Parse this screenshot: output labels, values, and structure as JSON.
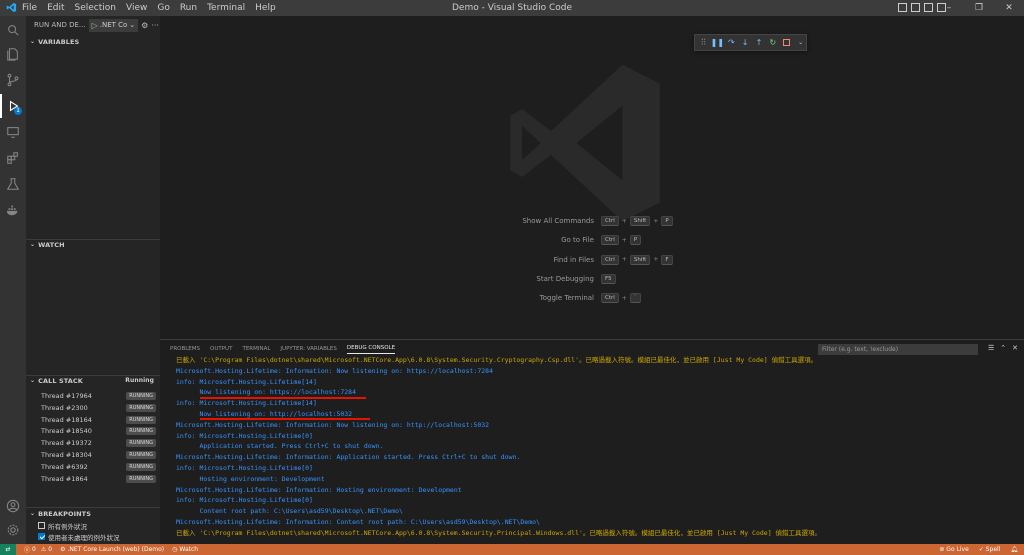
{
  "titlebar": {
    "menus": [
      "File",
      "Edit",
      "Selection",
      "View",
      "Go",
      "Run",
      "Terminal",
      "Help"
    ],
    "window_title": "Demo - Visual Studio Code",
    "window_controls": [
      "–",
      "❐",
      "✕"
    ]
  },
  "activity_badge": "1",
  "sidebar": {
    "run_label": "RUN AND DE...",
    "config_name": ".NET Co",
    "variables_header": "VARIABLES",
    "watch_header": "WATCH",
    "callstack_header": "CALL STACK",
    "callstack_status": "Running",
    "threads": [
      {
        "name": "Thread #17964",
        "state": "RUNNING"
      },
      {
        "name": "Thread #2300",
        "state": "RUNNING"
      },
      {
        "name": "Thread #18164",
        "state": "RUNNING"
      },
      {
        "name": "Thread #18540",
        "state": "RUNNING"
      },
      {
        "name": "Thread #19372",
        "state": "RUNNING"
      },
      {
        "name": "Thread #18304",
        "state": "RUNNING"
      },
      {
        "name": "Thread #6392",
        "state": "RUNNING"
      },
      {
        "name": "Thread #1864",
        "state": "RUNNING"
      }
    ],
    "breakpoints_header": "BREAKPOINTS",
    "breakpoints": [
      {
        "label": "所有例外狀況",
        "checked": false
      },
      {
        "label": "使用者未處理的例外狀況",
        "checked": true
      }
    ]
  },
  "editor": {
    "shortcuts": [
      {
        "label": "Show All Commands",
        "keys": [
          "Ctrl",
          "Shift",
          "P"
        ]
      },
      {
        "label": "Go to File",
        "keys": [
          "Ctrl",
          "P"
        ]
      },
      {
        "label": "Find in Files",
        "keys": [
          "Ctrl",
          "Shift",
          "F"
        ]
      },
      {
        "label": "Start Debugging",
        "keys": [
          "F5"
        ]
      },
      {
        "label": "Toggle Terminal",
        "keys": [
          "Ctrl",
          "`"
        ]
      }
    ]
  },
  "panel": {
    "tabs": [
      "PROBLEMS",
      "OUTPUT",
      "TERMINAL",
      "JUPYTER: VARIABLES",
      "DEBUG CONSOLE"
    ],
    "active_tab": "DEBUG CONSOLE",
    "filter_placeholder": "Filter (e.g. text, !exclude)",
    "console_lines": [
      {
        "text": "已載入 'C:\\Program Files\\dotnet\\shared\\Microsoft.NETCore.App\\6.0.8\\System.Security.Cryptography.Csp.dll'。已略過載入符號。模組已最佳化，並已啟用 [Just My Code] 偵錯工具選項。",
        "color": "yellow"
      },
      {
        "text": "Microsoft.Hosting.Lifetime: Information: Now listening on: https://localhost:7284",
        "color": "blue"
      },
      {
        "text": "info: Microsoft.Hosting.Lifetime[14]",
        "color": "blue"
      },
      {
        "text": "      Now listening on: https://localhost:7284",
        "color": "blue"
      },
      {
        "text": "info: Microsoft.Hosting.Lifetime[14]",
        "color": "blue"
      },
      {
        "text": "      Now listening on: http://localhost:5032",
        "color": "blue"
      },
      {
        "text": "Microsoft.Hosting.Lifetime: Information: Now listening on: http://localhost:5032",
        "color": "blue"
      },
      {
        "text": "info: Microsoft.Hosting.Lifetime[0]",
        "color": "blue"
      },
      {
        "text": "      Application started. Press Ctrl+C to shut down.",
        "color": "blue"
      },
      {
        "text": "Microsoft.Hosting.Lifetime: Information: Application started. Press Ctrl+C to shut down.",
        "color": "blue"
      },
      {
        "text": "info: Microsoft.Hosting.Lifetime[0]",
        "color": "blue"
      },
      {
        "text": "      Hosting environment: Development",
        "color": "blue"
      },
      {
        "text": "Microsoft.Hosting.Lifetime: Information: Hosting environment: Development",
        "color": "blue"
      },
      {
        "text": "info: Microsoft.Hosting.Lifetime[0]",
        "color": "blue"
      },
      {
        "text": "      Content root path: C:\\Users\\asd59\\Desktop\\.NET\\Demo\\",
        "color": "blue"
      },
      {
        "text": "Microsoft.Hosting.Lifetime: Information: Content root path: C:\\Users\\asd59\\Desktop\\.NET\\Demo\\",
        "color": "blue"
      },
      {
        "text": "已載入 'C:\\Program Files\\dotnet\\shared\\Microsoft.NETCore.App\\6.0.8\\System.Security.Principal.Windows.dll'。已略過載入符號。模組已最佳化，並已啟用 [Just My Code] 偵錯工具選項。",
        "color": "yellow"
      }
    ]
  },
  "statusbar": {
    "errors": "0",
    "warnings": "0",
    "launch": ".NET Core Launch (web) (Demo)",
    "watch": "Watch",
    "go_live": "Go Live",
    "spell": "Spell"
  },
  "colors": {
    "statusbar_bg": "#cc6633",
    "remote_bg": "#16825d",
    "console_blue": "#3794ff",
    "console_yellow": "#cca700",
    "underline_red": "#e51400"
  }
}
